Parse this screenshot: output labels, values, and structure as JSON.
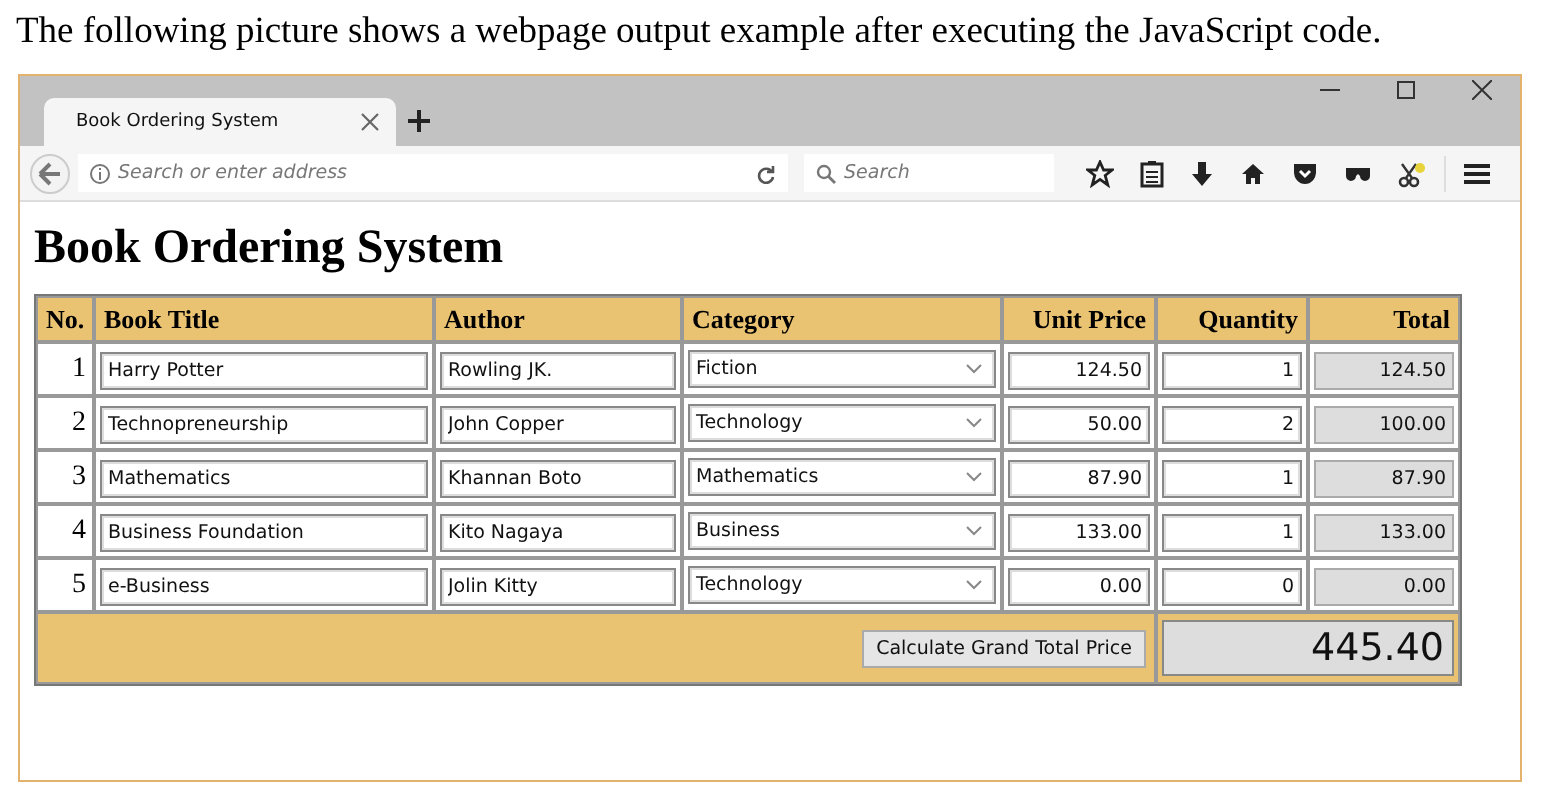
{
  "caption": "The following picture shows a webpage output example after executing the JavaScript code.",
  "browser": {
    "tab_title": "Book Ordering System",
    "address_placeholder": "Search or enter address",
    "search_placeholder": "Search"
  },
  "page": {
    "heading": "Book Ordering System",
    "table": {
      "columns": [
        "No.",
        "Book Title",
        "Author",
        "Category",
        "Unit Price",
        "Quantity",
        "Total"
      ],
      "rows": [
        {
          "no": "1",
          "title": "Harry Potter",
          "author": "Rowling JK.",
          "category": "Fiction",
          "unit_price": "124.50",
          "quantity": "1",
          "total": "124.50"
        },
        {
          "no": "2",
          "title": "Technopreneurship",
          "author": "John Copper",
          "category": "Technology",
          "unit_price": "50.00",
          "quantity": "2",
          "total": "100.00"
        },
        {
          "no": "3",
          "title": "Mathematics",
          "author": "Khannan Boto",
          "category": "Mathematics",
          "unit_price": "87.90",
          "quantity": "1",
          "total": "87.90"
        },
        {
          "no": "4",
          "title": "Business Foundation",
          "author": "Kito Nagaya",
          "category": "Business",
          "unit_price": "133.00",
          "quantity": "1",
          "total": "133.00"
        },
        {
          "no": "5",
          "title": "e-Business",
          "author": "Jolin Kitty",
          "category": "Technology",
          "unit_price": "0.00",
          "quantity": "0",
          "total": "0.00"
        }
      ],
      "calculate_button": "Calculate Grand Total Price",
      "grand_total": "445.40"
    }
  }
}
